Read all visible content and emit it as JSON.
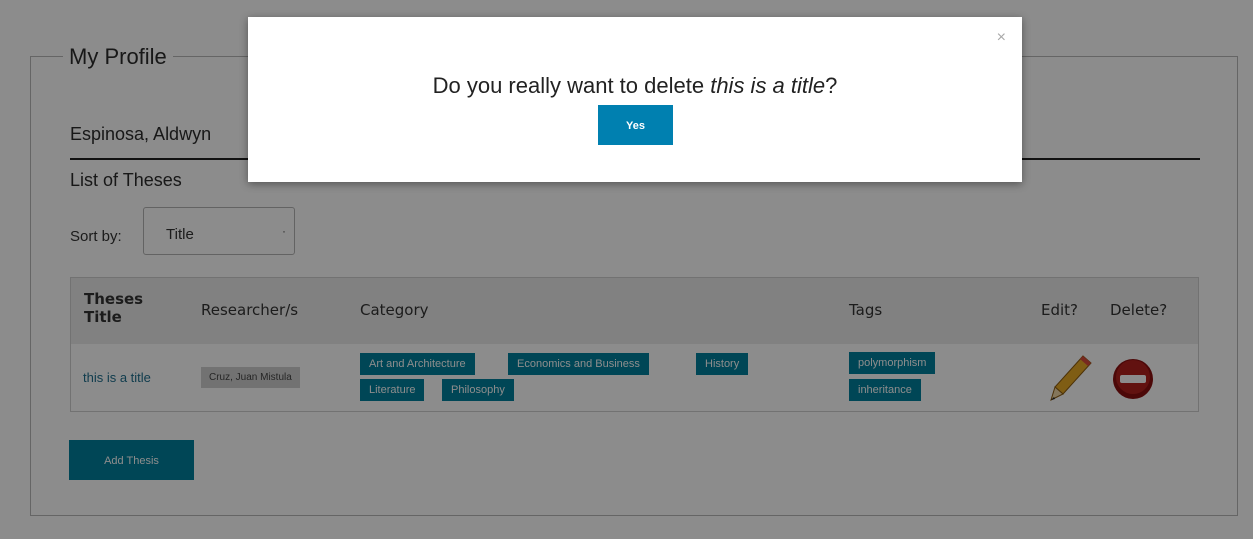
{
  "profile": {
    "legend": "My Profile",
    "name": "Espinosa, Aldwyn",
    "list_title": "List of Theses",
    "sort_label": "Sort by:",
    "sort_value": "Title"
  },
  "table": {
    "headers": [
      "Theses Title",
      "Researcher/s",
      "Category",
      "Tags",
      "Edit?",
      "Delete?"
    ],
    "row": {
      "title": "this is a title",
      "researcher": "Cruz, Juan Mistula",
      "categories": [
        "Art and Architecture",
        "Economics and Business",
        "History",
        "Literature",
        "Philosophy"
      ],
      "tags": [
        "polymorphism",
        "inheritance"
      ],
      "edit_icon": "pencil-icon",
      "delete_icon": "delete-icon"
    }
  },
  "actions": {
    "add_thesis": "Add Thesis"
  },
  "modal": {
    "close": "×",
    "prefix": "Do you really want to delete ",
    "title": "this is a title",
    "suffix": "?",
    "yes": "Yes"
  },
  "colors": {
    "accent": "#00809d",
    "button": "#0080b0",
    "overlay": "rgba(0,0,0,0.45)"
  }
}
